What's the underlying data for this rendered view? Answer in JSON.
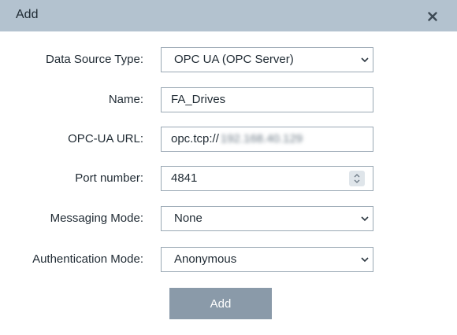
{
  "dialog": {
    "title": "Add",
    "close_icon": "close-icon",
    "submit_label": "Add"
  },
  "form": {
    "data_source_type": {
      "label": "Data Source Type:",
      "value": "OPC UA (OPC Server)"
    },
    "name": {
      "label": "Name:",
      "value": "FA_Drives"
    },
    "opcua_url": {
      "label": "OPC-UA URL:",
      "prefix": "opc.tcp://",
      "obscured": "192.168.40.129"
    },
    "port_number": {
      "label": "Port number:",
      "value": "4841"
    },
    "messaging_mode": {
      "label": "Messaging Mode:",
      "value": "None"
    },
    "authentication_mode": {
      "label": "Authentication Mode:",
      "value": "Anonymous"
    }
  },
  "colors": {
    "titlebar": "#b3c2cf",
    "field_border": "#9aa8b4",
    "button": "#8a9aa9"
  }
}
